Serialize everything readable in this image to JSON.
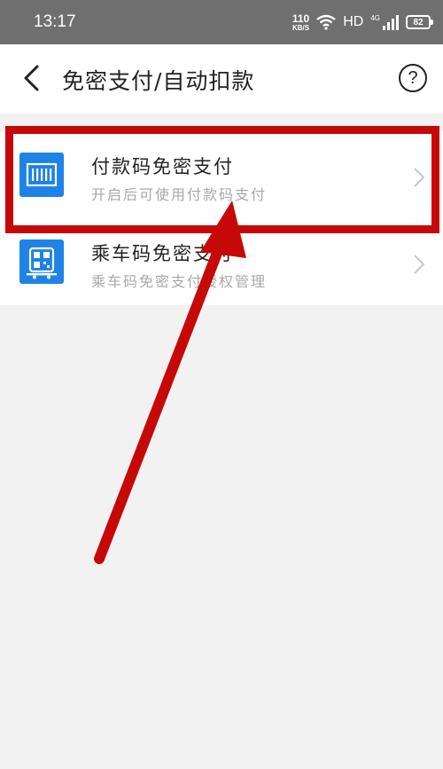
{
  "status_bar": {
    "time": "13:17",
    "net_speed_value": "110",
    "net_speed_unit": "KB/S",
    "hd": "HD",
    "signal_label": "4G",
    "battery": "82"
  },
  "header": {
    "title": "免密支付/自动扣款",
    "back_icon": "chevron-left-icon",
    "help_symbol": "?"
  },
  "list": {
    "items": [
      {
        "title": "付款码免密支付",
        "subtitle": "开启后可使用付款码支付",
        "icon": "barcode-icon"
      },
      {
        "title": "乘车码免密支付",
        "subtitle": "乘车码免密支付授权管理",
        "icon": "qr-code-icon"
      }
    ]
  },
  "colors": {
    "accent": "#1e82e6",
    "annotation": "#c70808",
    "status_bar": "#6f6f6f",
    "background": "#f2f2f2"
  }
}
